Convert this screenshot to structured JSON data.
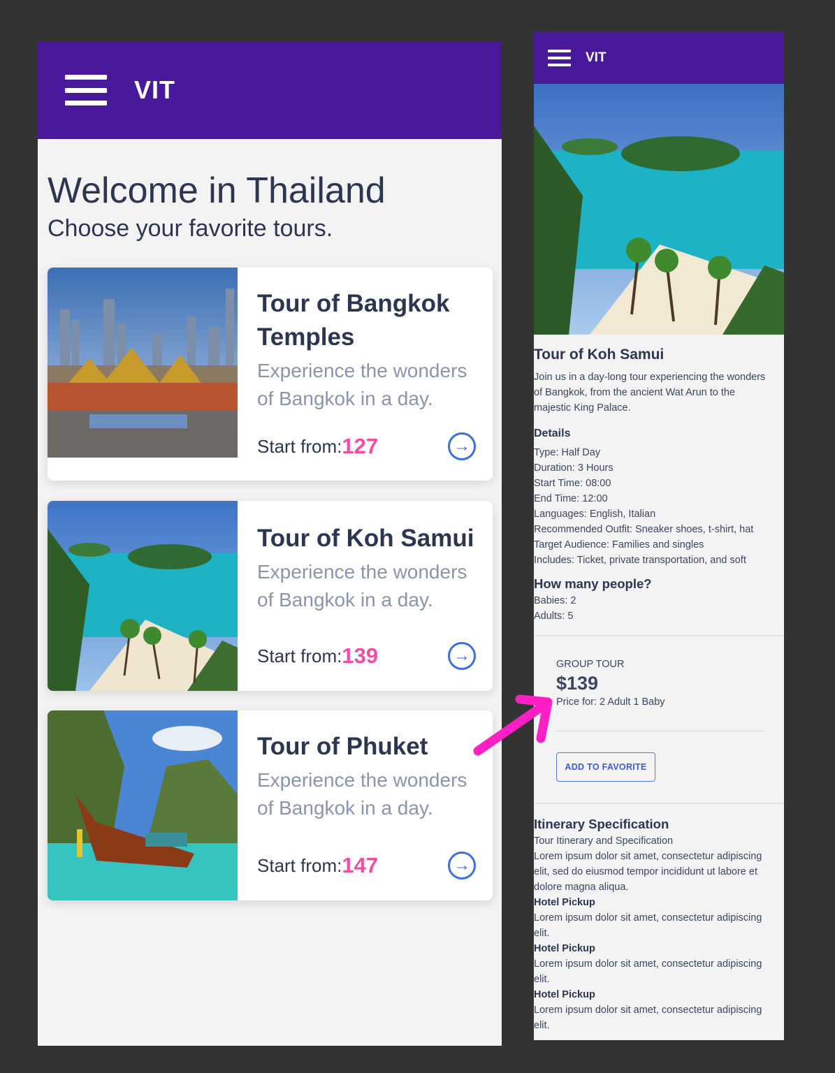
{
  "list_screen": {
    "brand": "VIT",
    "welcome_title": "Welcome in Thailand",
    "welcome_subtitle": "Choose your favorite tours.",
    "tours": [
      {
        "title_line1": "Tour of Bangkok",
        "title_line2": "Temples",
        "desc_line1": "Experience the wonders",
        "desc_line2": "of Bangkok in a day.",
        "price_label": "Start from:",
        "price": "127",
        "image": "bangkok-skyline-temples"
      },
      {
        "title_line1": "Tour of Koh Samui",
        "title_line2": "",
        "desc_line1": "Experience the wonders",
        "desc_line2": "of Bangkok in a day.",
        "price_label": "Start from:",
        "price": "139",
        "image": "koh-samui-beach"
      },
      {
        "title_line1": "Tour of Phuket",
        "title_line2": "",
        "desc_line1": "Experience the wonders",
        "desc_line2": "of Bangkok in a day.",
        "price_label": "Start from:",
        "price": "147",
        "image": "phuket-longtail-boat"
      }
    ],
    "arrow_icon": "arrow-right-circle-icon"
  },
  "detail_screen": {
    "brand": "VIT",
    "hero_image": "koh-samui-beach",
    "title": "Tour of Koh Samui",
    "intro_line1": "Join us in a day-long tour experiencing the wonders",
    "intro_line2": "of Bangkok, from the ancient Wat Arun to the",
    "intro_line3": "majestic King Palace.",
    "details_heading": "Details",
    "details": [
      "Type: Half Day",
      "Duration: 3 Hours",
      "Start Time: 08:00",
      "End Time: 12:00",
      "Languages: English, Italian",
      "Recommended Outfit: Sneaker shoes, t-shirt, hat",
      "Target Audience: Families and singles",
      "Includes: Ticket, private transportation, and soft"
    ],
    "people_heading": "How many people?",
    "people": [
      "Babies: 2",
      "Adults: 5"
    ],
    "group_label": "GROUP TOUR",
    "group_price": "$139",
    "group_note": "Price for: 2 Adult 1 Baby",
    "favorite_button": "ADD TO FAVORITE",
    "itinerary_heading": "Itinerary Specification",
    "itinerary_sub": "Tour Itinerary and Specification",
    "itinerary_text_1": "Lorem ipsum dolor sit amet, consectetur adipiscing",
    "itinerary_text_2": "elit, sed do eiusmod tempor incididunt ut labore et",
    "itinerary_text_3": "dolore magna aliqua.",
    "pickups": [
      {
        "heading": "Hotel Pickup",
        "line1": "Lorem ipsum dolor sit amet, consectetur adipiscing",
        "line2": "elit."
      },
      {
        "heading": "Hotel Pickup",
        "line1": "Lorem ipsum dolor sit amet, consectetur adipiscing",
        "line2": "elit."
      },
      {
        "heading": "Hotel Pickup",
        "line1": "Lorem ipsum dolor sit amet, consectetur adipiscing",
        "line2": "elit."
      }
    ]
  },
  "colors": {
    "background": "#333333",
    "appbar": "#48199a",
    "screen_bg": "#f3f3f4",
    "heading": "#2c3650",
    "muted": "#8a94ad",
    "price_pink": "#ef4fa3",
    "accent_blue": "#3b6ee5",
    "annotation_magenta": "#ff1fc4"
  }
}
